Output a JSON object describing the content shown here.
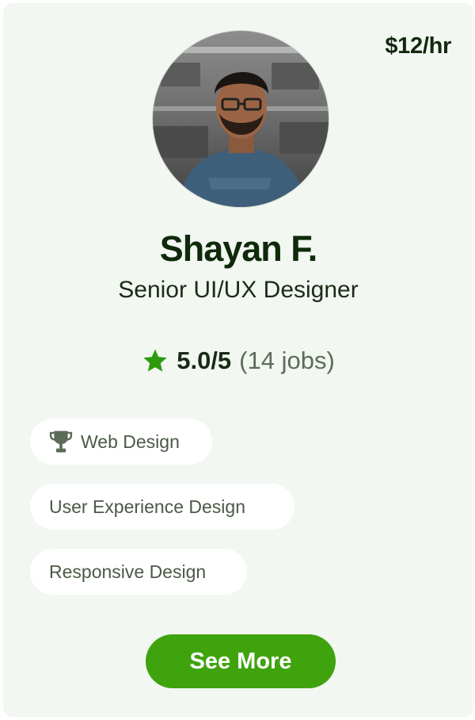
{
  "profile": {
    "rate": "$12/hr",
    "name": "Shayan F.",
    "title": "Senior UI/UX Designer",
    "rating_score": "5.0/5",
    "rating_jobs": "(14 jobs)"
  },
  "skills": [
    {
      "label": "Web Design",
      "icon": "trophy-icon"
    },
    {
      "label": "User Experience Design"
    },
    {
      "label": "Responsive Design"
    }
  ],
  "actions": {
    "see_more_label": "See More"
  },
  "colors": {
    "card_bg": "#f2f7f2",
    "accent_green": "#3fa30e",
    "star_green": "#2d9b0d",
    "heading": "#0f2a0a"
  },
  "icons": {
    "rating": "star-icon"
  }
}
